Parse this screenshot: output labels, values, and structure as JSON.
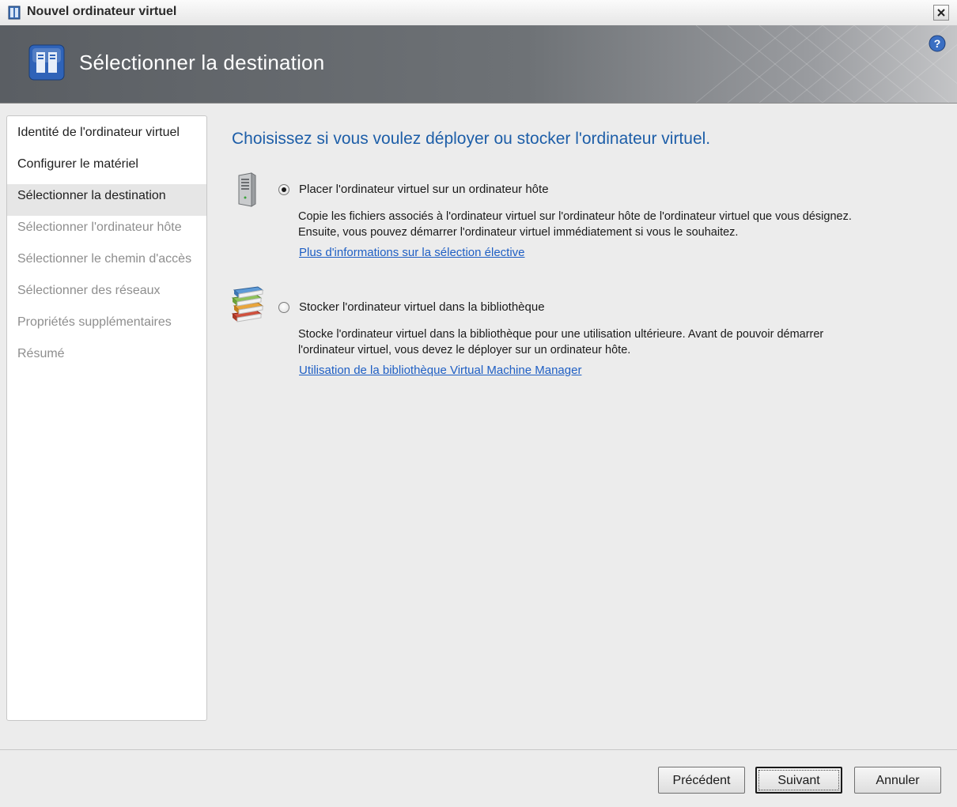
{
  "window": {
    "title": "Nouvel ordinateur virtuel",
    "icons": {
      "app": "server-doc-icon",
      "close": "close-icon"
    }
  },
  "header": {
    "title": "Sélectionner la destination",
    "icons": {
      "wizard": "wizard-page-icon",
      "help": "help-icon"
    }
  },
  "sidebar": {
    "items": [
      {
        "label": "Identité de l'ordinateur virtuel",
        "state": "done"
      },
      {
        "label": "Configurer le matériel",
        "state": "done"
      },
      {
        "label": "Sélectionner la destination",
        "state": "active"
      },
      {
        "label": "Sélectionner l'ordinateur hôte",
        "state": "pending"
      },
      {
        "label": "Sélectionner le chemin d'accès",
        "state": "pending"
      },
      {
        "label": "Sélectionner des réseaux",
        "state": "pending"
      },
      {
        "label": "Propriétés supplémentaires",
        "state": "pending"
      },
      {
        "label": "Résumé",
        "state": "pending"
      }
    ]
  },
  "main": {
    "heading": "Choisissez si vous voulez déployer ou stocker l'ordinateur virtuel.",
    "options": [
      {
        "icon": "server-icon",
        "label": "Placer l'ordinateur virtuel sur un ordinateur hôte",
        "selected": true,
        "desc_line1": "Copie les fichiers associés à l'ordinateur virtuel sur l'ordinateur hôte de l'ordinateur virtuel que vous désignez.",
        "desc_line2": "Ensuite, vous pouvez démarrer l'ordinateur virtuel immédiatement si vous le souhaitez.",
        "link": "Plus d'informations sur la sélection élective"
      },
      {
        "icon": "library-books-icon",
        "label": "Stocker l'ordinateur virtuel dans la bibliothèque",
        "selected": false,
        "desc_line1": "Stocke l'ordinateur virtuel dans la bibliothèque pour une utilisation ultérieure. Avant de pouvoir démarrer",
        "desc_line2": "l'ordinateur virtuel, vous devez le déployer sur un ordinateur hôte.",
        "link": "Utilisation de la bibliothèque Virtual Machine Manager"
      }
    ]
  },
  "footer": {
    "back_label": "Précédent",
    "next_label": "Suivant",
    "cancel_label": "Annuler"
  }
}
